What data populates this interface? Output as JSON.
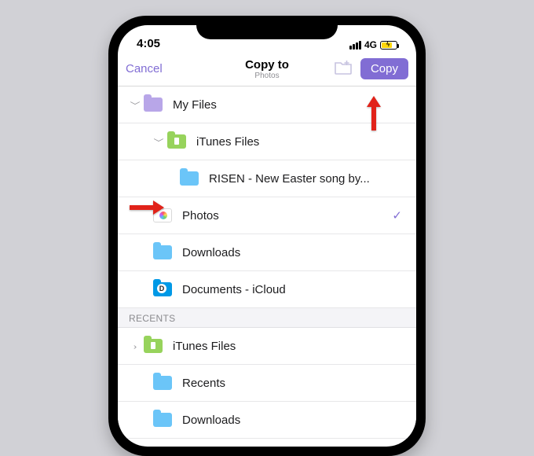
{
  "statusbar": {
    "time": "4:05",
    "network": "4G"
  },
  "header": {
    "cancel": "Cancel",
    "title": "Copy to",
    "subtitle": "Photos",
    "copy": "Copy"
  },
  "tree": {
    "myfiles": "My Files",
    "itunes": "iTunes Files",
    "risen": "RISEN - New Easter song by...",
    "photos": "Photos",
    "downloads": "Downloads",
    "icloud": "Documents - iCloud"
  },
  "sections": {
    "recents": "RECENTS"
  },
  "recents": {
    "itunes": "iTunes Files",
    "recentsFolder": "Recents",
    "downloads": "Downloads"
  }
}
